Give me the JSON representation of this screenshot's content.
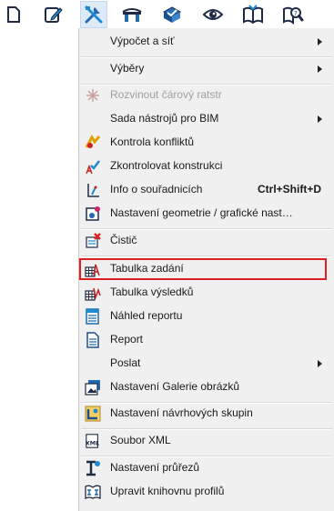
{
  "toolbar": {
    "buttons": [
      {
        "icon": "new-document-icon"
      },
      {
        "icon": "edit-icon"
      },
      {
        "icon": "tools-icon",
        "active": true
      },
      {
        "icon": "bridge-icon"
      },
      {
        "icon": "check-icon"
      },
      {
        "icon": "eye-icon"
      },
      {
        "icon": "book-icon"
      },
      {
        "icon": "help-search-icon"
      }
    ]
  },
  "menu": {
    "items": [
      {
        "label": "Výpočet a síť",
        "submenu": true
      },
      {
        "label": "Výběry",
        "submenu": true
      },
      {
        "label": "Rozvinout čárový ratstr",
        "disabled": true
      },
      {
        "label": "Sada nástrojů pro BIM",
        "submenu": true
      },
      {
        "label": "Kontrola konfliktů"
      },
      {
        "label": "Zkontrolovat konstrukci"
      },
      {
        "label": "Info o souřadnicích",
        "shortcut": "Ctrl+Shift+D"
      },
      {
        "label": "Nastavení geometrie / grafické nast…"
      },
      {
        "label": "Čistič"
      },
      {
        "label": "Tabulka zadání"
      },
      {
        "label": "Tabulka výsledků"
      },
      {
        "label": "Náhled reportu"
      },
      {
        "label": "Report"
      },
      {
        "label": "Poslat",
        "submenu": true
      },
      {
        "label": "Nastavení Galerie obrázků"
      },
      {
        "label": "Nastavení návrhových skupin"
      },
      {
        "label": "Soubor XML"
      },
      {
        "label": "Nastavení průřezů"
      },
      {
        "label": "Upravit knihovnu profilů"
      }
    ]
  },
  "colors": {
    "menu_bg": "#f0f0f0",
    "highlight_border": "#e02020",
    "toolbar_active_bg": "#ddeaf7",
    "icon_blue": "#1f6ab0"
  }
}
